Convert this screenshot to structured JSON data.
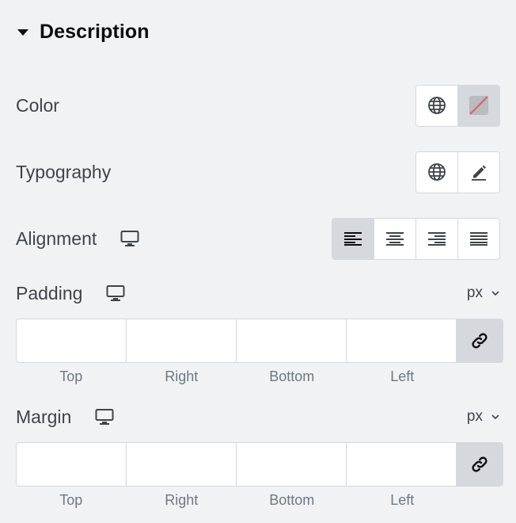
{
  "section": {
    "title": "Description"
  },
  "color": {
    "label": "Color"
  },
  "typography": {
    "label": "Typography"
  },
  "alignment": {
    "label": "Alignment",
    "options": [
      "align-left",
      "align-center",
      "align-right",
      "align-justify"
    ],
    "selected": "align-left"
  },
  "padding": {
    "label": "Padding",
    "unit": "px",
    "fields": {
      "top": "",
      "right": "",
      "bottom": "",
      "left": ""
    },
    "labels": {
      "top": "Top",
      "right": "Right",
      "bottom": "Bottom",
      "left": "Left"
    }
  },
  "margin": {
    "label": "Margin",
    "unit": "px",
    "fields": {
      "top": "",
      "right": "",
      "bottom": "",
      "left": ""
    },
    "labels": {
      "top": "Top",
      "right": "Right",
      "bottom": "Bottom",
      "left": "Left"
    }
  },
  "colors": {
    "panel_bg": "#f1f2f3",
    "border": "#d5d8dc",
    "active_bg": "#d5d8dc",
    "text": "#3f444b",
    "muted": "#6d7882",
    "swatch_slash": "#e35b5b"
  },
  "icons": {
    "globe": "globe-icon",
    "pencil": "pencil-icon",
    "desktop": "desktop-icon",
    "link": "link-icon",
    "chevron": "chevron-down-icon"
  }
}
